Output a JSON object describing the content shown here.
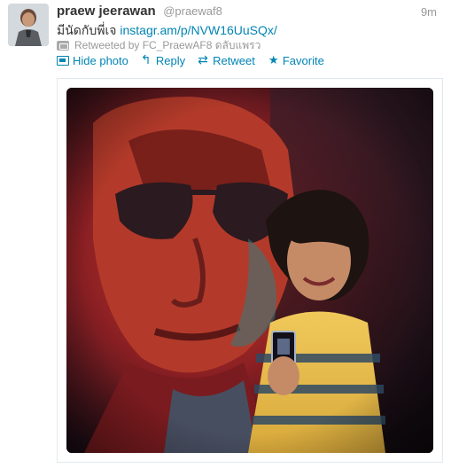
{
  "tweet": {
    "fullname": "praew jeerawan",
    "username": "@praewaf8",
    "time": "9m",
    "text_prefix": "มีนัดกับพี่เจ ",
    "link": "instagr.am/p/NVW16UuSQx/",
    "retweeted_by": "Retweeted by FC_PraewAF8 ดลับแพรว"
  },
  "actions": {
    "hide_photo": "Hide photo",
    "reply": "Reply",
    "retweet": "Retweet",
    "favorite": "Favorite"
  },
  "colors": {
    "link": "#0084b4",
    "muted": "#999999",
    "text": "#333333"
  },
  "icons": {
    "hide_photo": "photo-icon",
    "reply": "reply-icon",
    "retweet": "retweet-icon",
    "favorite": "star-icon"
  }
}
